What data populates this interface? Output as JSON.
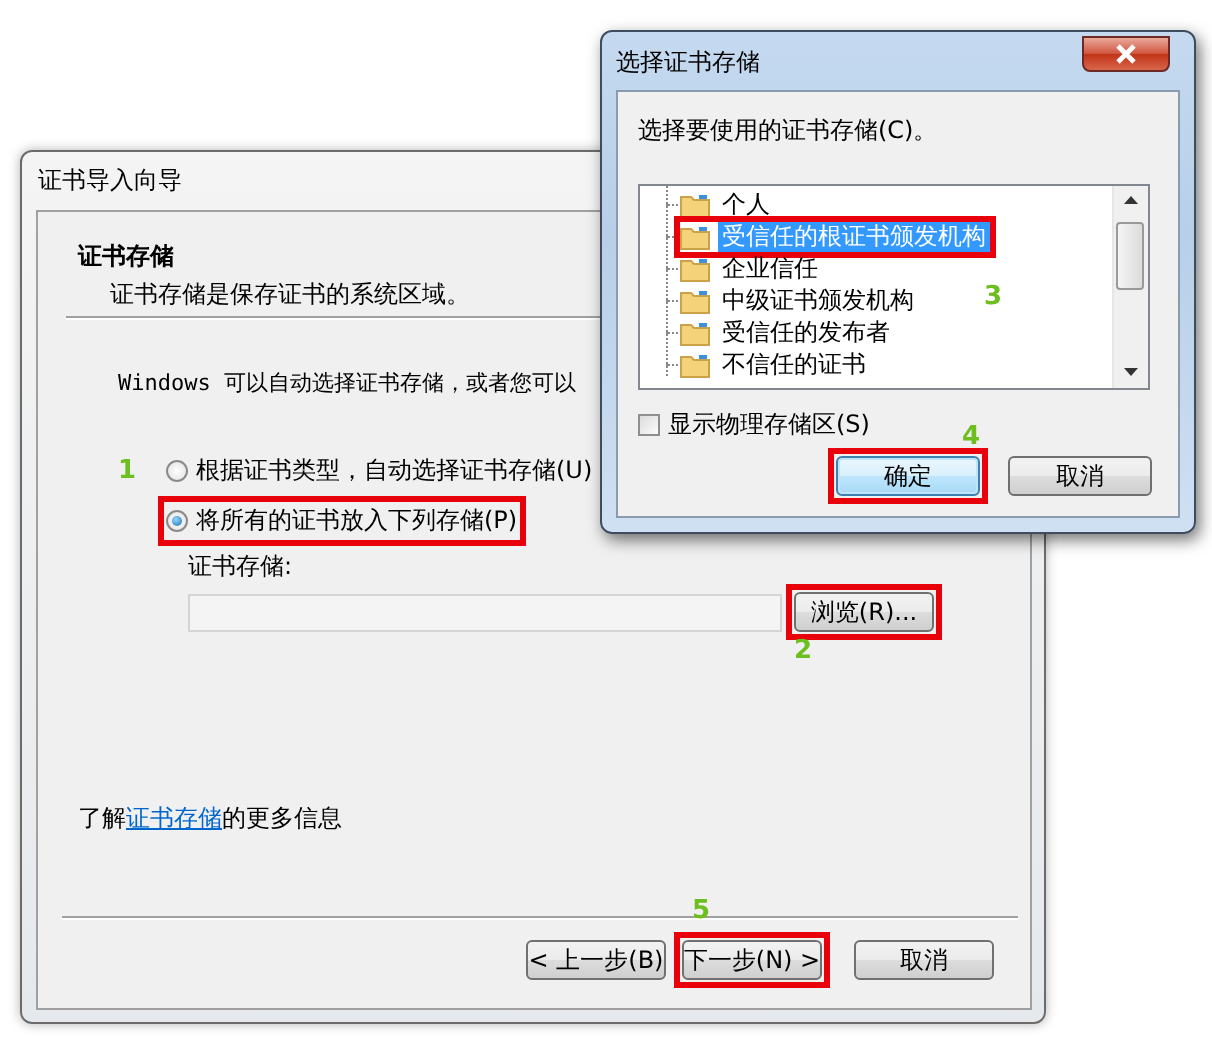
{
  "wizard": {
    "title": "证书导入向导",
    "heading": "证书存储",
    "subheading": "证书存储是保存证书的系统区域。",
    "intro": "Windows 可以自动选择证书存储，或者您可以",
    "options": [
      {
        "label": "根据证书类型，自动选择证书存储(U)",
        "selected": false,
        "highlighted": false
      },
      {
        "label": "将所有的证书放入下列存储(P)",
        "selected": true,
        "highlighted": true
      }
    ],
    "option_marker": "1",
    "store_label": "证书存储:",
    "browse_button": {
      "label": "浏览(R)...",
      "highlighted": true,
      "marker": "2"
    },
    "link_sentence": {
      "before": "了解",
      "link": "证书存储",
      "after": "的更多信息"
    },
    "buttons": [
      {
        "label": "< 上一步(B)",
        "highlighted": false
      },
      {
        "label": "下一步(N) >",
        "highlighted": true,
        "marker": "5"
      },
      {
        "label": "取消",
        "highlighted": false
      }
    ]
  },
  "dialog": {
    "title": "选择证书存储",
    "prompt": "选择要使用的证书存储(C)。",
    "tree": {
      "items": [
        {
          "label": "个人",
          "selected": false,
          "highlighted": false
        },
        {
          "label": "受信任的根证书颁发机构",
          "selected": true,
          "highlighted": true,
          "marker": "3"
        },
        {
          "label": "企业信任",
          "selected": false,
          "highlighted": false
        },
        {
          "label": "中级证书颁发机构",
          "selected": false,
          "highlighted": false
        },
        {
          "label": "受信任的发布者",
          "selected": false,
          "highlighted": false
        },
        {
          "label": "不信任的证书",
          "selected": false,
          "highlighted": false
        }
      ]
    },
    "show_physical": {
      "label": "显示物理存储区(S)",
      "checked": false
    },
    "buttons": [
      {
        "label": "确定",
        "default": true,
        "highlighted": true,
        "marker": "4"
      },
      {
        "label": "取消",
        "default": false,
        "highlighted": false
      }
    ]
  }
}
